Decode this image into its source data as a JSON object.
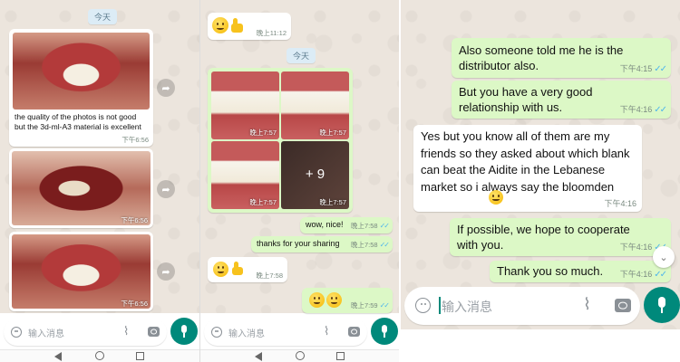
{
  "colors": {
    "outgoing": "#dcf8c6",
    "incoming": "#ffffff",
    "tick": "#4fb6ec",
    "mic": "#00897b"
  },
  "panel1": {
    "date_chip": "今天",
    "messages": [
      {
        "caption": "the quality of the photos is not good but the 3d-ml-A3 material is excellent",
        "time": "下午6:56"
      },
      {
        "time": "下午6:56"
      },
      {
        "time": "下午6:56"
      }
    ]
  },
  "panel2": {
    "top_time": "晚上11:12",
    "date_chip": "今天",
    "grid_times": [
      "晚上7:57",
      "晚上7:57",
      "晚上7:57",
      "晚上7:57"
    ],
    "more_count": "+ 9",
    "messages": [
      {
        "text": "wow, nice!",
        "time": "晚上7:58"
      },
      {
        "text": "thanks for your sharing",
        "time": "晚上7:58"
      },
      {
        "time": "晚上7:58"
      },
      {
        "time": "晚上7:59"
      }
    ]
  },
  "panel3": {
    "messages": [
      {
        "text": "Also someone told me he is the distributor also.",
        "time": "下午4:15"
      },
      {
        "text": "But you have a very good relationship with us.",
        "time": "下午4:16"
      },
      {
        "text": "Yes but you know all of them are my friends so they asked about which blank can beat the Aidite in the Lebanese market so i always say the bloomden",
        "time": "下午4:16"
      },
      {
        "text": "If possible, we hope to cooperate with you.",
        "time": "下午4:16"
      },
      {
        "text": "Thank you so much.",
        "time": "下午4:16"
      }
    ]
  },
  "input": {
    "placeholder": "输入消息"
  },
  "icons": {
    "share": "forward-icon",
    "emoji": "smiley-icon",
    "attach": "paperclip-icon",
    "camera": "camera-icon",
    "mic": "microphone-icon",
    "scroll": "chevron-down-icon"
  }
}
